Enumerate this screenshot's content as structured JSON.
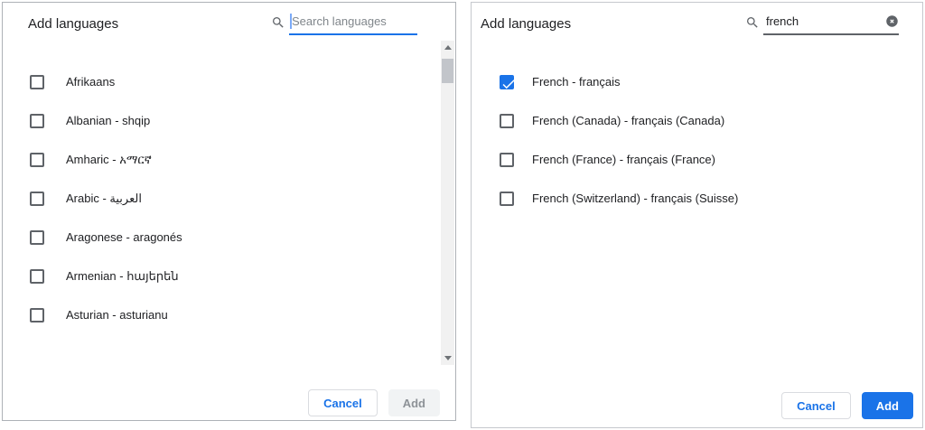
{
  "colors": {
    "accent": "#1a73e8",
    "text_primary": "#202124",
    "text_secondary": "#5f6368",
    "placeholder": "#80868b",
    "disabled_button_bg": "#f1f3f4",
    "disabled_button_text": "#8d9297",
    "button_border": "#dadce0"
  },
  "icons": {
    "search": "magnifier",
    "clear": "circled-x",
    "check": "checkmark",
    "scroll_up": "triangle-up",
    "scroll_down": "triangle-down"
  },
  "dialogs": [
    {
      "title": "Add languages",
      "search": {
        "placeholder": "Search languages",
        "value": "",
        "focused": true
      },
      "items": [
        {
          "label": "Afrikaans",
          "checked": false
        },
        {
          "label": "Albanian - shqip",
          "checked": false
        },
        {
          "label": "Amharic - አማርኛ",
          "checked": false
        },
        {
          "label": "Arabic - العربية",
          "checked": false
        },
        {
          "label": "Aragonese - aragonés",
          "checked": false
        },
        {
          "label": "Armenian - հայերեն",
          "checked": false
        },
        {
          "label": "Asturian - asturianu",
          "checked": false
        }
      ],
      "buttons": {
        "cancel": "Cancel",
        "add": "Add",
        "add_enabled": false
      },
      "has_scrollbar": true
    },
    {
      "title": "Add languages",
      "search": {
        "placeholder": "",
        "value": "french",
        "focused": false
      },
      "items": [
        {
          "label": "French - français",
          "checked": true
        },
        {
          "label": "French (Canada) - français (Canada)",
          "checked": false
        },
        {
          "label": "French (France) - français (France)",
          "checked": false
        },
        {
          "label": "French (Switzerland) - français (Suisse)",
          "checked": false
        }
      ],
      "buttons": {
        "cancel": "Cancel",
        "add": "Add",
        "add_enabled": true
      },
      "has_scrollbar": false
    }
  ]
}
